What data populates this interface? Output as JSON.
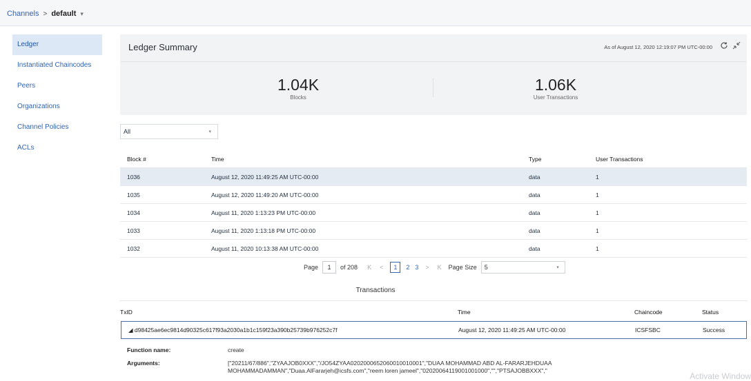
{
  "breadcrumb": {
    "channels": "Channels",
    "separator": ">",
    "current": "default",
    "caret": "▾"
  },
  "sidebar": {
    "items": [
      {
        "label": "Ledger",
        "active": true
      },
      {
        "label": "Instantiated Chaincodes"
      },
      {
        "label": "Peers"
      },
      {
        "label": "Organizations"
      },
      {
        "label": "Channel Policies"
      },
      {
        "label": "ACLs"
      }
    ]
  },
  "summary": {
    "title": "Ledger Summary",
    "as_of": "As of August 12, 2020 12:19:07 PM UTC-00:00",
    "blocks_value": "1.04K",
    "blocks_label": "Blocks",
    "tx_value": "1.06K",
    "tx_label": "User Transactions"
  },
  "filter": {
    "value": "All",
    "caret": "▾"
  },
  "blocks_table": {
    "headers": {
      "block": "Block #",
      "time": "Time",
      "type": "Type",
      "user_tx": "User Transactions"
    },
    "rows": [
      {
        "block": "1036",
        "time": "August 12, 2020 11:49:25 AM UTC-00:00",
        "type": "data",
        "user_tx": "1"
      },
      {
        "block": "1035",
        "time": "August 12, 2020 11:49:20 AM UTC-00:00",
        "type": "data",
        "user_tx": "1"
      },
      {
        "block": "1034",
        "time": "August 11, 2020 1:13:23 PM UTC-00:00",
        "type": "data",
        "user_tx": "1"
      },
      {
        "block": "1033",
        "time": "August 11, 2020 1:13:18 PM UTC-00:00",
        "type": "data",
        "user_tx": "1"
      },
      {
        "block": "1032",
        "time": "August 11, 2020 10:13:38 AM UTC-00:00",
        "type": "data",
        "user_tx": "1"
      }
    ]
  },
  "pagination": {
    "page_label": "Page",
    "page_value": "1",
    "of_text": "of 208",
    "first": "K",
    "prev": "<",
    "pages": [
      "1",
      "2",
      "3"
    ],
    "next": ">",
    "last": "K",
    "page_size_label": "Page Size",
    "page_size_value": "5",
    "caret": "▾"
  },
  "transactions": {
    "title": "Transactions",
    "headers": {
      "txid": "TxID",
      "time": "Time",
      "chaincode": "Chaincode",
      "status": "Status"
    },
    "row": {
      "txid": "◢  d98425ae6ec9814d90325c617f93a2030a1b1c159f23a390b25739b976252c7f",
      "time": "August 12, 2020 11:49:25 AM UTC-00:00",
      "chaincode": "ICSFSBC",
      "status": "Success"
    },
    "function_label": "Function name:",
    "function_value": "create",
    "arguments_label": "Arguments:",
    "arguments_line1": "[\"20211/67/886\",\"ZYAAJOB0XXX\",\"/JO54ZYAA0202000652060010010001\",\"DUAA MOHAMMAD ABD AL-FARARJEHDUAA",
    "arguments_line2": "MOHAMMADAMMAN\",\"Duaa.AlFararjeh@icsfs.com\",\"reem loren jameel\",\"02020064119001001000\",\"\",\"PTSAJOBBXXX\",\""
  },
  "watermark": "Activate Windows"
}
